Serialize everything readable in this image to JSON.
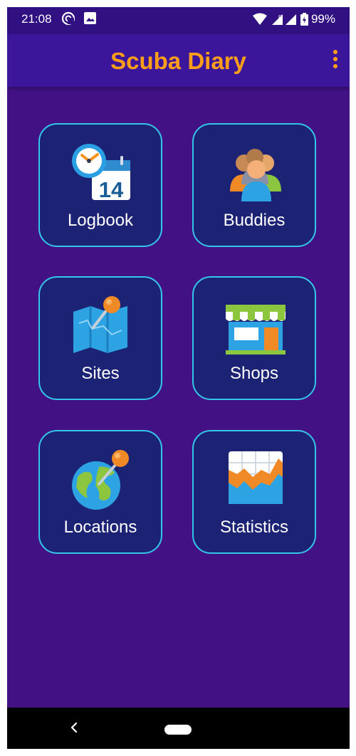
{
  "status_bar": {
    "time": "21:08",
    "battery": "99%",
    "icons": [
      "sync-icon",
      "image-icon",
      "wifi-icon",
      "signal-icon",
      "battery-icon"
    ]
  },
  "app_bar": {
    "title": "Scuba Diary",
    "menu_icon": "more-vert-icon"
  },
  "tiles": [
    {
      "label": "Logbook",
      "icon": "calendar-clock-icon"
    },
    {
      "label": "Buddies",
      "icon": "people-group-icon"
    },
    {
      "label": "Sites",
      "icon": "map-pin-icon"
    },
    {
      "label": "Shops",
      "icon": "storefront-icon"
    },
    {
      "label": "Locations",
      "icon": "globe-pin-icon"
    },
    {
      "label": "Statistics",
      "icon": "area-chart-icon"
    }
  ],
  "nav_bar": {
    "back_icon": "back-chevron-icon",
    "home_icon": "home-pill-icon"
  },
  "colors": {
    "background": "#421284",
    "app_bar": "#3b169b",
    "accent": "#ff9e1a",
    "tile_fill": "#1c2375",
    "tile_border": "#35c4ea"
  }
}
